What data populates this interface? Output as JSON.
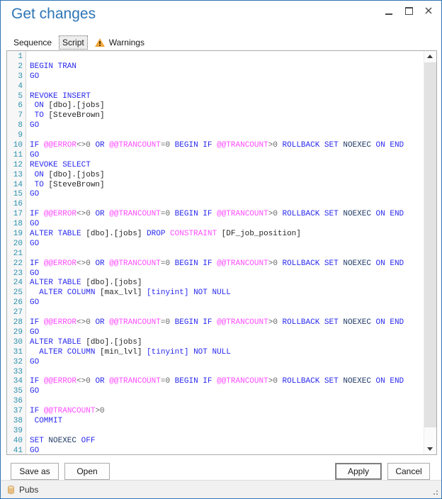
{
  "window": {
    "title": "Get changes",
    "controls": [
      {
        "name": "minimize"
      },
      {
        "name": "maximize"
      },
      {
        "name": "close"
      }
    ]
  },
  "tabs": {
    "sequence": "Sequence",
    "script": "Script",
    "warnings": "Warnings",
    "selected": "Script"
  },
  "colors": {
    "window_border": "#2E74B5",
    "title": "#2E75B6",
    "warning_icon": "#F0A63C",
    "keyword": "#2A2AEE",
    "system": "#FF4DFF",
    "identifier": "#262626",
    "operator": "#666666",
    "option": "#203A66",
    "line_number": "#2B91AF"
  },
  "editor": {
    "lines": [
      {
        "n": 1,
        "segments": []
      },
      {
        "n": 2,
        "segments": [
          {
            "t": "kw",
            "s": "BEGIN TRAN"
          }
        ]
      },
      {
        "n": 3,
        "segments": [
          {
            "t": "kw",
            "s": "GO"
          }
        ]
      },
      {
        "n": 4,
        "segments": []
      },
      {
        "n": 5,
        "segments": [
          {
            "t": "kw",
            "s": "REVOKE INSERT"
          }
        ]
      },
      {
        "n": 6,
        "segments": [
          {
            "t": "kw",
            "s": " ON "
          },
          {
            "t": "id",
            "s": "[dbo].[jobs]"
          }
        ]
      },
      {
        "n": 7,
        "segments": [
          {
            "t": "kw",
            "s": " TO "
          },
          {
            "t": "id",
            "s": "[SteveBrown]"
          }
        ]
      },
      {
        "n": 8,
        "segments": [
          {
            "t": "kw",
            "s": "GO"
          }
        ]
      },
      {
        "n": 9,
        "segments": []
      },
      {
        "n": 10,
        "segments": [
          {
            "t": "kw",
            "s": "IF "
          },
          {
            "t": "sys",
            "s": "@@ERROR"
          },
          {
            "t": "op",
            "s": "<>0"
          },
          {
            "t": "kw",
            "s": " OR "
          },
          {
            "t": "sys",
            "s": "@@TRANCOUNT"
          },
          {
            "t": "op",
            "s": "=0"
          },
          {
            "t": "kw",
            "s": " BEGIN IF "
          },
          {
            "t": "sys",
            "s": "@@TRANCOUNT"
          },
          {
            "t": "op",
            "s": ">0"
          },
          {
            "t": "kw",
            "s": " ROLLBACK SET "
          },
          {
            "t": "opt",
            "s": "NOEXEC"
          },
          {
            "t": "kw",
            "s": " ON END"
          }
        ]
      },
      {
        "n": 11,
        "segments": [
          {
            "t": "kw",
            "s": "GO"
          }
        ]
      },
      {
        "n": 12,
        "segments": [
          {
            "t": "kw",
            "s": "REVOKE SELECT"
          }
        ]
      },
      {
        "n": 13,
        "segments": [
          {
            "t": "kw",
            "s": " ON "
          },
          {
            "t": "id",
            "s": "[dbo].[jobs]"
          }
        ]
      },
      {
        "n": 14,
        "segments": [
          {
            "t": "kw",
            "s": " TO "
          },
          {
            "t": "id",
            "s": "[SteveBrown]"
          }
        ]
      },
      {
        "n": 15,
        "segments": [
          {
            "t": "kw",
            "s": "GO"
          }
        ]
      },
      {
        "n": 16,
        "segments": []
      },
      {
        "n": 17,
        "segments": [
          {
            "t": "kw",
            "s": "IF "
          },
          {
            "t": "sys",
            "s": "@@ERROR"
          },
          {
            "t": "op",
            "s": "<>0"
          },
          {
            "t": "kw",
            "s": " OR "
          },
          {
            "t": "sys",
            "s": "@@TRANCOUNT"
          },
          {
            "t": "op",
            "s": "=0"
          },
          {
            "t": "kw",
            "s": " BEGIN IF "
          },
          {
            "t": "sys",
            "s": "@@TRANCOUNT"
          },
          {
            "t": "op",
            "s": ">0"
          },
          {
            "t": "kw",
            "s": " ROLLBACK SET "
          },
          {
            "t": "opt",
            "s": "NOEXEC"
          },
          {
            "t": "kw",
            "s": " ON END"
          }
        ]
      },
      {
        "n": 18,
        "segments": [
          {
            "t": "kw",
            "s": "GO"
          }
        ]
      },
      {
        "n": 19,
        "segments": [
          {
            "t": "kw",
            "s": "ALTER TABLE "
          },
          {
            "t": "id",
            "s": "[dbo].[jobs]"
          },
          {
            "t": "kw",
            "s": " DROP "
          },
          {
            "t": "sys",
            "s": "CONSTRAINT"
          },
          {
            "t": "id",
            "s": " [DF_job_position]"
          }
        ]
      },
      {
        "n": 20,
        "segments": [
          {
            "t": "kw",
            "s": "GO"
          }
        ]
      },
      {
        "n": 21,
        "segments": []
      },
      {
        "n": 22,
        "segments": [
          {
            "t": "kw",
            "s": "IF "
          },
          {
            "t": "sys",
            "s": "@@ERROR"
          },
          {
            "t": "op",
            "s": "<>0"
          },
          {
            "t": "kw",
            "s": " OR "
          },
          {
            "t": "sys",
            "s": "@@TRANCOUNT"
          },
          {
            "t": "op",
            "s": "=0"
          },
          {
            "t": "kw",
            "s": " BEGIN IF "
          },
          {
            "t": "sys",
            "s": "@@TRANCOUNT"
          },
          {
            "t": "op",
            "s": ">0"
          },
          {
            "t": "kw",
            "s": " ROLLBACK SET "
          },
          {
            "t": "opt",
            "s": "NOEXEC"
          },
          {
            "t": "kw",
            "s": " ON END"
          }
        ]
      },
      {
        "n": 23,
        "segments": [
          {
            "t": "kw",
            "s": "GO"
          }
        ]
      },
      {
        "n": 24,
        "segments": [
          {
            "t": "kw",
            "s": "ALTER TABLE "
          },
          {
            "t": "id",
            "s": "[dbo].[jobs]"
          }
        ]
      },
      {
        "n": 25,
        "segments": [
          {
            "t": "kw",
            "s": "  ALTER COLUMN "
          },
          {
            "t": "id",
            "s": "[max_lvl]"
          },
          {
            "t": "kw",
            "s": " [tinyint] NOT NULL"
          }
        ]
      },
      {
        "n": 26,
        "segments": [
          {
            "t": "kw",
            "s": "GO"
          }
        ]
      },
      {
        "n": 27,
        "segments": []
      },
      {
        "n": 28,
        "segments": [
          {
            "t": "kw",
            "s": "IF "
          },
          {
            "t": "sys",
            "s": "@@ERROR"
          },
          {
            "t": "op",
            "s": "<>0"
          },
          {
            "t": "kw",
            "s": " OR "
          },
          {
            "t": "sys",
            "s": "@@TRANCOUNT"
          },
          {
            "t": "op",
            "s": "=0"
          },
          {
            "t": "kw",
            "s": " BEGIN IF "
          },
          {
            "t": "sys",
            "s": "@@TRANCOUNT"
          },
          {
            "t": "op",
            "s": ">0"
          },
          {
            "t": "kw",
            "s": " ROLLBACK SET "
          },
          {
            "t": "opt",
            "s": "NOEXEC"
          },
          {
            "t": "kw",
            "s": " ON END"
          }
        ]
      },
      {
        "n": 29,
        "segments": [
          {
            "t": "kw",
            "s": "GO"
          }
        ]
      },
      {
        "n": 30,
        "segments": [
          {
            "t": "kw",
            "s": "ALTER TABLE "
          },
          {
            "t": "id",
            "s": "[dbo].[jobs]"
          }
        ]
      },
      {
        "n": 31,
        "segments": [
          {
            "t": "kw",
            "s": "  ALTER COLUMN "
          },
          {
            "t": "id",
            "s": "[min_lvl]"
          },
          {
            "t": "kw",
            "s": " [tinyint] NOT NULL"
          }
        ]
      },
      {
        "n": 32,
        "segments": [
          {
            "t": "kw",
            "s": "GO"
          }
        ]
      },
      {
        "n": 33,
        "segments": []
      },
      {
        "n": 34,
        "segments": [
          {
            "t": "kw",
            "s": "IF "
          },
          {
            "t": "sys",
            "s": "@@ERROR"
          },
          {
            "t": "op",
            "s": "<>0"
          },
          {
            "t": "kw",
            "s": " OR "
          },
          {
            "t": "sys",
            "s": "@@TRANCOUNT"
          },
          {
            "t": "op",
            "s": "=0"
          },
          {
            "t": "kw",
            "s": " BEGIN IF "
          },
          {
            "t": "sys",
            "s": "@@TRANCOUNT"
          },
          {
            "t": "op",
            "s": ">0"
          },
          {
            "t": "kw",
            "s": " ROLLBACK SET "
          },
          {
            "t": "opt",
            "s": "NOEXEC"
          },
          {
            "t": "kw",
            "s": " ON END"
          }
        ]
      },
      {
        "n": 35,
        "segments": [
          {
            "t": "kw",
            "s": "GO"
          }
        ]
      },
      {
        "n": 36,
        "segments": []
      },
      {
        "n": 37,
        "segments": [
          {
            "t": "kw",
            "s": "IF "
          },
          {
            "t": "sys",
            "s": "@@TRANCOUNT"
          },
          {
            "t": "op",
            "s": ">0"
          }
        ]
      },
      {
        "n": 38,
        "segments": [
          {
            "t": "kw",
            "s": " COMMIT"
          }
        ]
      },
      {
        "n": 39,
        "segments": []
      },
      {
        "n": 40,
        "segments": [
          {
            "t": "kw",
            "s": "SET "
          },
          {
            "t": "opt",
            "s": "NOEXEC"
          },
          {
            "t": "kw",
            "s": " OFF"
          }
        ]
      },
      {
        "n": 41,
        "segments": [
          {
            "t": "kw",
            "s": "GO"
          }
        ]
      }
    ]
  },
  "buttons": {
    "save_as": "Save as",
    "open": "Open",
    "apply": "Apply",
    "cancel": "Cancel"
  },
  "status_bar": {
    "database": "Pubs",
    "database_icon": "database-icon"
  }
}
